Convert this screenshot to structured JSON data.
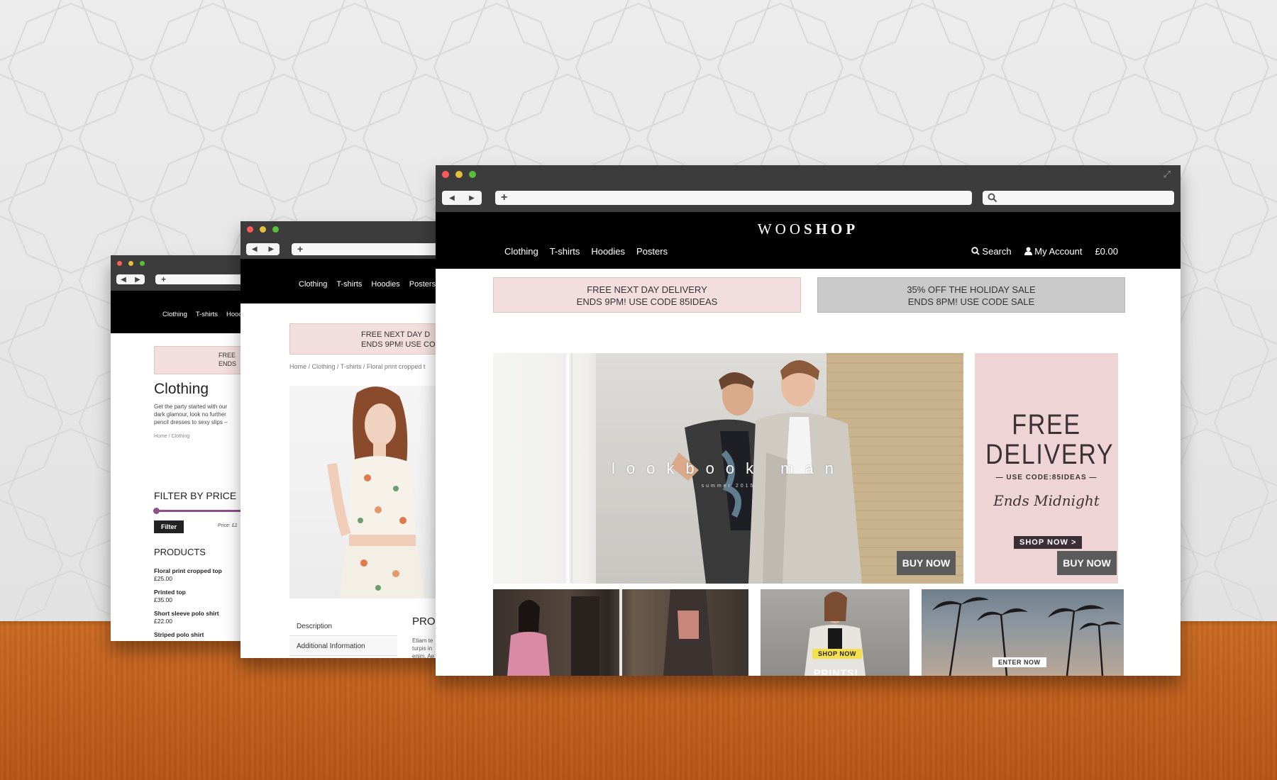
{
  "main_window": {
    "logo_light": "WOO",
    "logo_bold": "SHOP",
    "nav": [
      "Clothing",
      "T-shirts",
      "Hoodies",
      "Posters"
    ],
    "search_label": "Search",
    "account_label": "My Account",
    "cart_total": "£0.00",
    "promo_left": {
      "line1": "FREE NEXT DAY DELIVERY",
      "line2": "ENDS 9PM! USE CODE 85IDEAS"
    },
    "promo_right": {
      "line1": "35% OFF THE HOLIDAY SALE",
      "line2": "ENDS 8PM! USE CODE SALE"
    },
    "hero": {
      "title": "lookbook man",
      "subtitle": "summer 2015",
      "button": "BUY NOW"
    },
    "side_banner": {
      "line1": "FREE",
      "line2": "DELIVERY",
      "code": "— USE CODE:85IDEAS —",
      "ends": "Ends Midnight",
      "shop": "SHOP NOW >",
      "button": "BUY NOW"
    },
    "tiles": {
      "shop_now": "SHOP NOW",
      "prints": "PRINTS!",
      "enter_now": "ENTER NOW"
    }
  },
  "middle_window": {
    "nav": [
      "Clothing",
      "T-shirts",
      "Hoodies",
      "Posters"
    ],
    "promo_line1": "FREE NEXT DAY D",
    "promo_line2": "ENDS 9PM! USE CO",
    "breadcrumb": "Home / Clothing / T-shirts / Floral print cropped t",
    "tabs": [
      "Description",
      "Additional Information"
    ],
    "section_heading": "PRO",
    "body_snippet": [
      "Etiam te",
      "turpis in",
      "enim. Ae"
    ]
  },
  "back_window": {
    "nav": [
      "Clothing",
      "T-shirts",
      "Hood"
    ],
    "promo_line1": "FREE",
    "promo_line2": "ENDS",
    "title": "Clothing",
    "description": [
      "Get the party started with our",
      "dark glamour, look no further",
      "pencil dresses to sexy slips –"
    ],
    "breadcrumb": "Home / Clothing",
    "filter_heading": "FILTER BY PRICE",
    "filter_button": "Filter",
    "price_label": "Price: £2",
    "products_heading": "PRODUCTS",
    "products": [
      {
        "name": "Floral print cropped top",
        "price": "£25.00"
      },
      {
        "name": "Printed top",
        "price": "£35.00"
      },
      {
        "name": "Short sleeve polo shirt",
        "price": "£22.00"
      },
      {
        "name": "Striped polo shirt",
        "price": ""
      }
    ]
  },
  "colors": {
    "promo_pink": "#f2dfdd",
    "promo_grey": "#c9c9c9",
    "banner_pink": "#efd4d5",
    "header_black": "#000000",
    "chrome_dark": "#3c3c3c",
    "filter_purple": "#8e4f8a"
  }
}
